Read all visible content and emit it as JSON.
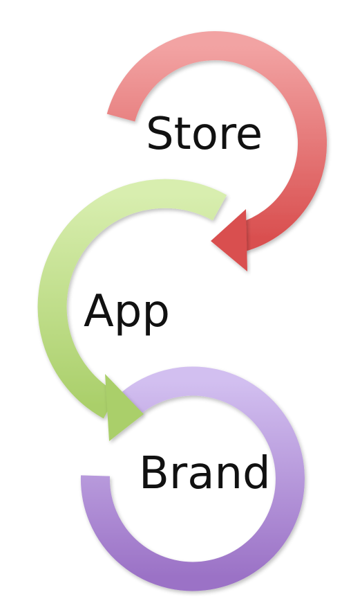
{
  "diagram": {
    "labels": {
      "store": "Store",
      "app": "App",
      "brand": "Brand"
    },
    "colors": {
      "store_arrow": "#e07373",
      "app_arrow": "#bedd8a",
      "brand_ring": "#b797d9"
    }
  }
}
